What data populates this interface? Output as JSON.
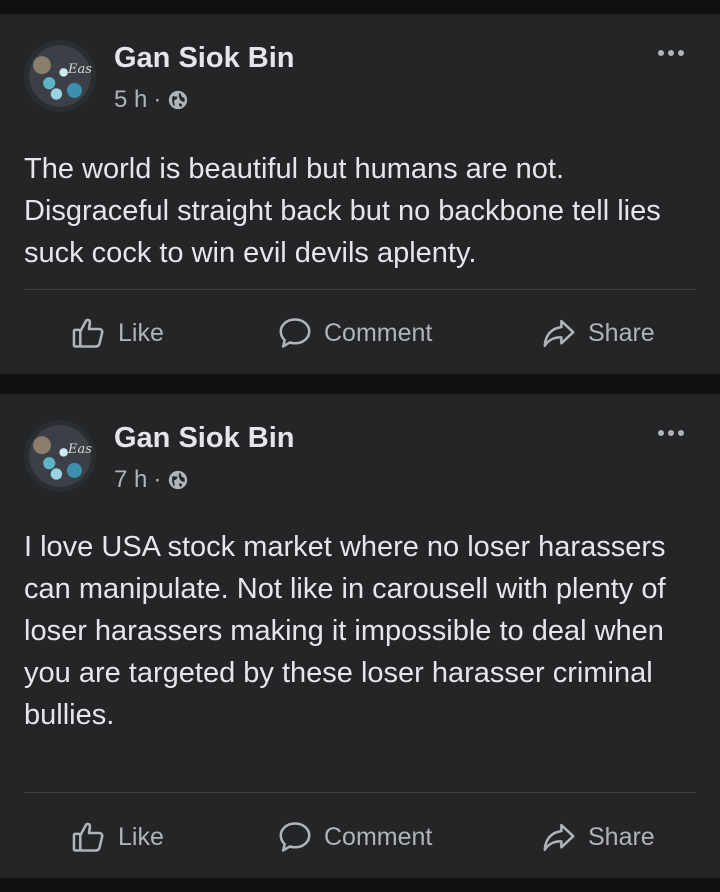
{
  "posts": [
    {
      "author": "Gan Siok Bin",
      "avatar_text": "Eas",
      "time": "5 h",
      "separator": "·",
      "privacy_icon": "globe-icon",
      "text": "The world is beautiful but humans are not. Disgraceful straight back but no backbone tell lies suck cock to win evil devils aplenty.",
      "actions": {
        "like": "Like",
        "comment": "Comment",
        "share": "Share"
      }
    },
    {
      "author": "Gan Siok Bin",
      "avatar_text": "Eas",
      "time": "7 h",
      "separator": "·",
      "privacy_icon": "globe-icon",
      "text": "I love USA stock market where no loser harassers can manipulate. Not like in carousell with plenty of loser harassers making it impossible to deal when you are targeted by these loser harasser criminal bullies.",
      "actions": {
        "like": "Like",
        "comment": "Comment",
        "share": "Share"
      }
    }
  ],
  "colors": {
    "background": "#101010",
    "card": "#242526",
    "primary_text": "#e4e6eb",
    "secondary_text": "#b0b3b8",
    "divider": "#3e4042"
  }
}
